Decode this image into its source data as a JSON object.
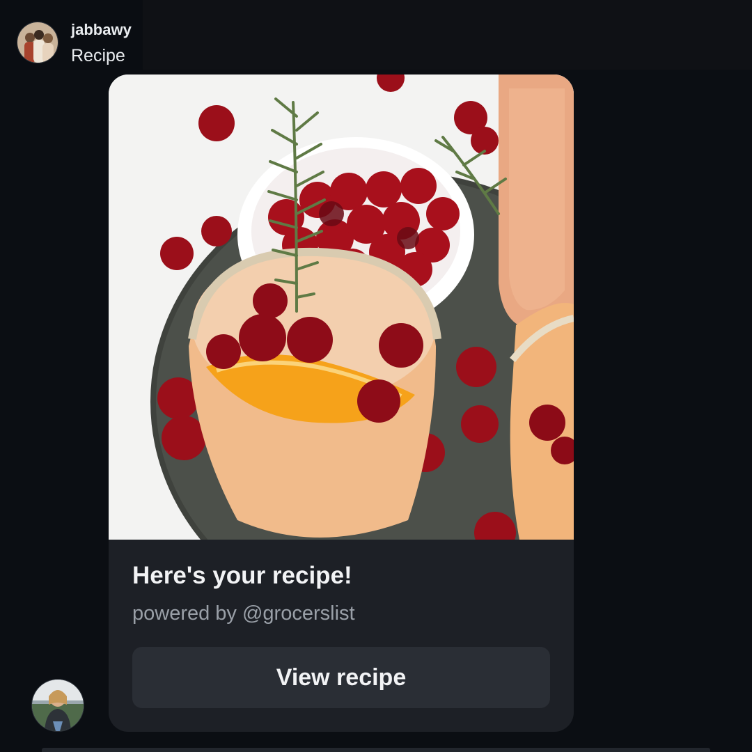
{
  "conversation": {
    "sender_name": "jabbawy",
    "subtitle": "Recipe",
    "sender_avatar": "avatar",
    "my_avatar": "avatar"
  },
  "recipe_card": {
    "image_description_icon": "cocktail-photo",
    "title": "Here's your recipe!",
    "powered_by": "powered by @grocerslist",
    "button_label": "View recipe"
  },
  "colors": {
    "background": "#0b0e13",
    "card": "#1d2026",
    "button": "#2a2e35",
    "muted_text": "#9aa0a8"
  }
}
